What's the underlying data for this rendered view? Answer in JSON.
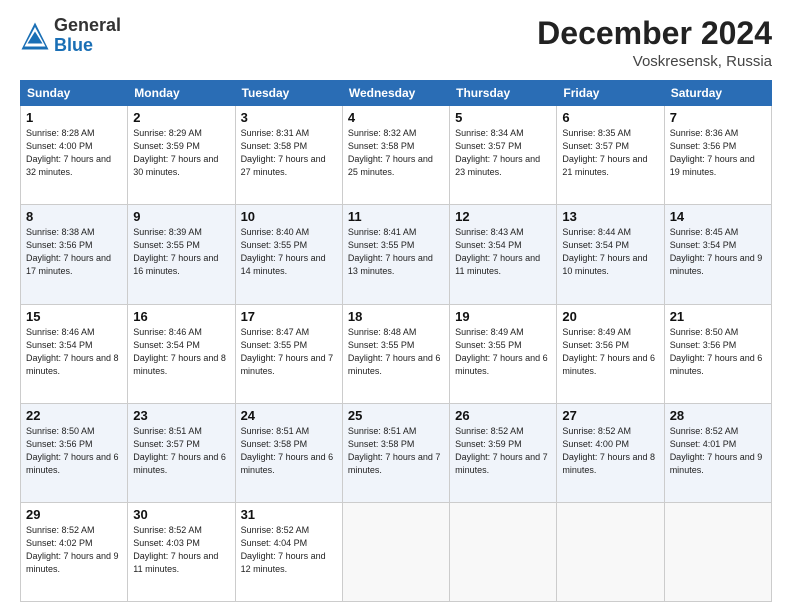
{
  "header": {
    "logo_general": "General",
    "logo_blue": "Blue",
    "month_title": "December 2024",
    "location": "Voskresensk, Russia"
  },
  "days_of_week": [
    "Sunday",
    "Monday",
    "Tuesday",
    "Wednesday",
    "Thursday",
    "Friday",
    "Saturday"
  ],
  "weeks": [
    [
      {
        "day": "1",
        "sunrise": "Sunrise: 8:28 AM",
        "sunset": "Sunset: 4:00 PM",
        "daylight": "Daylight: 7 hours and 32 minutes."
      },
      {
        "day": "2",
        "sunrise": "Sunrise: 8:29 AM",
        "sunset": "Sunset: 3:59 PM",
        "daylight": "Daylight: 7 hours and 30 minutes."
      },
      {
        "day": "3",
        "sunrise": "Sunrise: 8:31 AM",
        "sunset": "Sunset: 3:58 PM",
        "daylight": "Daylight: 7 hours and 27 minutes."
      },
      {
        "day": "4",
        "sunrise": "Sunrise: 8:32 AM",
        "sunset": "Sunset: 3:58 PM",
        "daylight": "Daylight: 7 hours and 25 minutes."
      },
      {
        "day": "5",
        "sunrise": "Sunrise: 8:34 AM",
        "sunset": "Sunset: 3:57 PM",
        "daylight": "Daylight: 7 hours and 23 minutes."
      },
      {
        "day": "6",
        "sunrise": "Sunrise: 8:35 AM",
        "sunset": "Sunset: 3:57 PM",
        "daylight": "Daylight: 7 hours and 21 minutes."
      },
      {
        "day": "7",
        "sunrise": "Sunrise: 8:36 AM",
        "sunset": "Sunset: 3:56 PM",
        "daylight": "Daylight: 7 hours and 19 minutes."
      }
    ],
    [
      {
        "day": "8",
        "sunrise": "Sunrise: 8:38 AM",
        "sunset": "Sunset: 3:56 PM",
        "daylight": "Daylight: 7 hours and 17 minutes."
      },
      {
        "day": "9",
        "sunrise": "Sunrise: 8:39 AM",
        "sunset": "Sunset: 3:55 PM",
        "daylight": "Daylight: 7 hours and 16 minutes."
      },
      {
        "day": "10",
        "sunrise": "Sunrise: 8:40 AM",
        "sunset": "Sunset: 3:55 PM",
        "daylight": "Daylight: 7 hours and 14 minutes."
      },
      {
        "day": "11",
        "sunrise": "Sunrise: 8:41 AM",
        "sunset": "Sunset: 3:55 PM",
        "daylight": "Daylight: 7 hours and 13 minutes."
      },
      {
        "day": "12",
        "sunrise": "Sunrise: 8:43 AM",
        "sunset": "Sunset: 3:54 PM",
        "daylight": "Daylight: 7 hours and 11 minutes."
      },
      {
        "day": "13",
        "sunrise": "Sunrise: 8:44 AM",
        "sunset": "Sunset: 3:54 PM",
        "daylight": "Daylight: 7 hours and 10 minutes."
      },
      {
        "day": "14",
        "sunrise": "Sunrise: 8:45 AM",
        "sunset": "Sunset: 3:54 PM",
        "daylight": "Daylight: 7 hours and 9 minutes."
      }
    ],
    [
      {
        "day": "15",
        "sunrise": "Sunrise: 8:46 AM",
        "sunset": "Sunset: 3:54 PM",
        "daylight": "Daylight: 7 hours and 8 minutes."
      },
      {
        "day": "16",
        "sunrise": "Sunrise: 8:46 AM",
        "sunset": "Sunset: 3:54 PM",
        "daylight": "Daylight: 7 hours and 8 minutes."
      },
      {
        "day": "17",
        "sunrise": "Sunrise: 8:47 AM",
        "sunset": "Sunset: 3:55 PM",
        "daylight": "Daylight: 7 hours and 7 minutes."
      },
      {
        "day": "18",
        "sunrise": "Sunrise: 8:48 AM",
        "sunset": "Sunset: 3:55 PM",
        "daylight": "Daylight: 7 hours and 6 minutes."
      },
      {
        "day": "19",
        "sunrise": "Sunrise: 8:49 AM",
        "sunset": "Sunset: 3:55 PM",
        "daylight": "Daylight: 7 hours and 6 minutes."
      },
      {
        "day": "20",
        "sunrise": "Sunrise: 8:49 AM",
        "sunset": "Sunset: 3:56 PM",
        "daylight": "Daylight: 7 hours and 6 minutes."
      },
      {
        "day": "21",
        "sunrise": "Sunrise: 8:50 AM",
        "sunset": "Sunset: 3:56 PM",
        "daylight": "Daylight: 7 hours and 6 minutes."
      }
    ],
    [
      {
        "day": "22",
        "sunrise": "Sunrise: 8:50 AM",
        "sunset": "Sunset: 3:56 PM",
        "daylight": "Daylight: 7 hours and 6 minutes."
      },
      {
        "day": "23",
        "sunrise": "Sunrise: 8:51 AM",
        "sunset": "Sunset: 3:57 PM",
        "daylight": "Daylight: 7 hours and 6 minutes."
      },
      {
        "day": "24",
        "sunrise": "Sunrise: 8:51 AM",
        "sunset": "Sunset: 3:58 PM",
        "daylight": "Daylight: 7 hours and 6 minutes."
      },
      {
        "day": "25",
        "sunrise": "Sunrise: 8:51 AM",
        "sunset": "Sunset: 3:58 PM",
        "daylight": "Daylight: 7 hours and 7 minutes."
      },
      {
        "day": "26",
        "sunrise": "Sunrise: 8:52 AM",
        "sunset": "Sunset: 3:59 PM",
        "daylight": "Daylight: 7 hours and 7 minutes."
      },
      {
        "day": "27",
        "sunrise": "Sunrise: 8:52 AM",
        "sunset": "Sunset: 4:00 PM",
        "daylight": "Daylight: 7 hours and 8 minutes."
      },
      {
        "day": "28",
        "sunrise": "Sunrise: 8:52 AM",
        "sunset": "Sunset: 4:01 PM",
        "daylight": "Daylight: 7 hours and 9 minutes."
      }
    ],
    [
      {
        "day": "29",
        "sunrise": "Sunrise: 8:52 AM",
        "sunset": "Sunset: 4:02 PM",
        "daylight": "Daylight: 7 hours and 9 minutes."
      },
      {
        "day": "30",
        "sunrise": "Sunrise: 8:52 AM",
        "sunset": "Sunset: 4:03 PM",
        "daylight": "Daylight: 7 hours and 11 minutes."
      },
      {
        "day": "31",
        "sunrise": "Sunrise: 8:52 AM",
        "sunset": "Sunset: 4:04 PM",
        "daylight": "Daylight: 7 hours and 12 minutes."
      },
      null,
      null,
      null,
      null
    ]
  ]
}
